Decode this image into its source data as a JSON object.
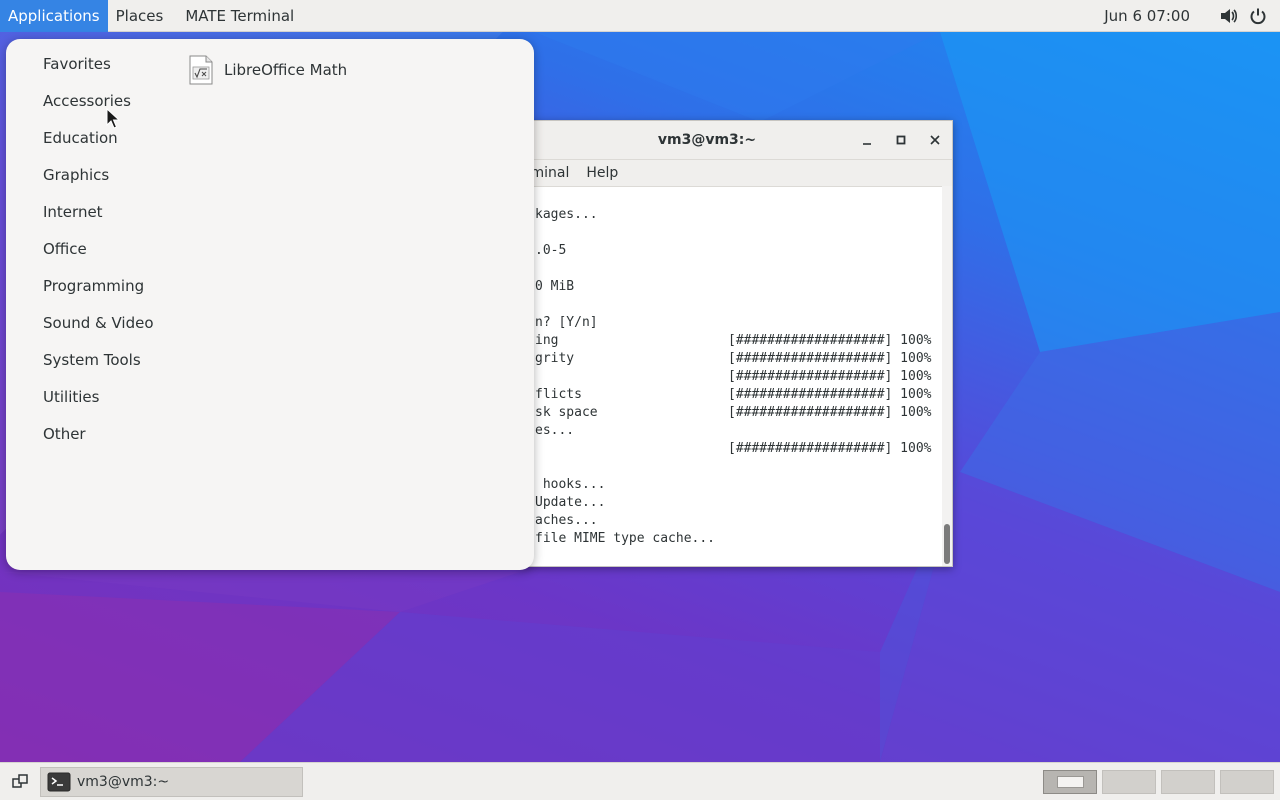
{
  "top_panel": {
    "applications": "Applications",
    "places": "Places",
    "terminal": "MATE Terminal",
    "clock": "Jun 6  07:00",
    "icons": [
      "volume-icon",
      "power-icon"
    ]
  },
  "app_menu": {
    "categories": [
      "Favorites",
      "Accessories",
      "Education",
      "Graphics",
      "Internet",
      "Office",
      "Programming",
      "Sound & Video",
      "System Tools",
      "Utilities",
      "Other"
    ],
    "apps": [
      {
        "label": "LibreOffice Math",
        "icon": "libreoffice-math-icon"
      }
    ]
  },
  "terminal": {
    "title": "vm3@vm3:~",
    "menu": [
      "rminal",
      "Help"
    ],
    "lines": [
      "kages...",
      "",
      ".0-5",
      "",
      "0 MiB",
      "",
      "n? [Y/n]",
      "ing",
      "grity",
      "",
      "flicts",
      "sk space",
      "es...",
      "",
      "",
      " hooks...",
      "Update...",
      "aches...",
      "file MIME type cache..."
    ],
    "progress": [
      {
        "line": 7,
        "text": "[###################] 100%"
      },
      {
        "line": 8,
        "text": "[###################] 100%"
      },
      {
        "line": 9,
        "text": "[###################] 100%"
      },
      {
        "line": 10,
        "text": "[###################] 100%"
      },
      {
        "line": 11,
        "text": "[###################] 100%"
      },
      {
        "line": 13,
        "text": "[###################] 100%"
      }
    ]
  },
  "bottom_panel": {
    "task_label": "vm3@vm3:~",
    "workspaces": 4,
    "active_workspace": 1
  }
}
